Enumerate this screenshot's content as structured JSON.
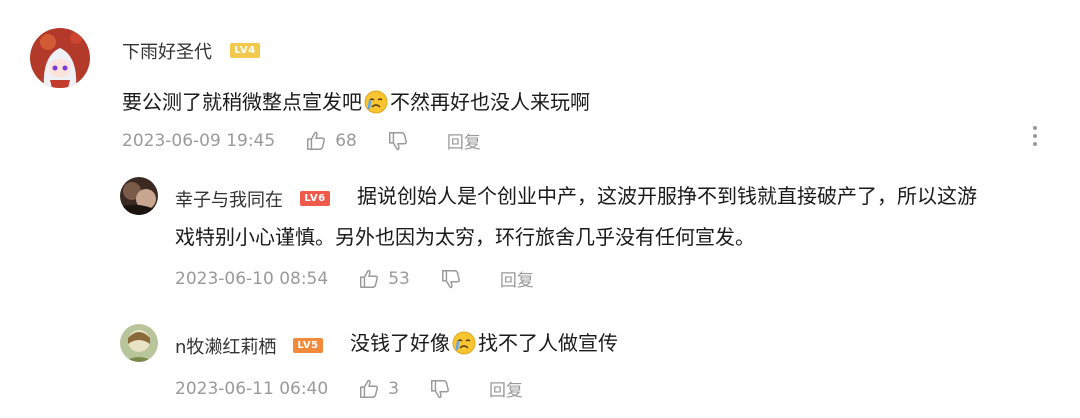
{
  "comments": [
    {
      "username": "下雨好圣代",
      "level": "LV4",
      "text_before": "要公测了就稍微整点宣发吧",
      "emoji": "crying-face",
      "text_after": "不然再好也没人来玩啊",
      "time": "2023-06-09 19:45",
      "likes": "68",
      "reply_label": "回复"
    },
    {
      "username": "幸子与我同在",
      "level": "LV6",
      "text_line1": "据说创始人是个创业中产，这波开服挣不到钱就直接破产了，所以这游",
      "text_line2": "戏特别小心谨慎。另外也因为太穷，环行旅舍几乎没有任何宣发。",
      "time": "2023-06-10 08:54",
      "likes": "53",
      "reply_label": "回复"
    },
    {
      "username": "n牧濑红莉栖",
      "level": "LV5",
      "text_before": "没钱了好像",
      "emoji": "crying-face",
      "text_after": "找不了人做宣传",
      "time": "2023-06-11 06:40",
      "likes": "3",
      "reply_label": "回复"
    }
  ],
  "icons": {
    "like": "thumbs-up-icon",
    "dislike": "thumbs-down-icon",
    "more": "more-vertical-icon"
  },
  "colors": {
    "meta_text": "#9a9a9a",
    "lv4": "#f2c94c",
    "lv5": "#f28a3a",
    "lv6": "#ef5a4a"
  }
}
